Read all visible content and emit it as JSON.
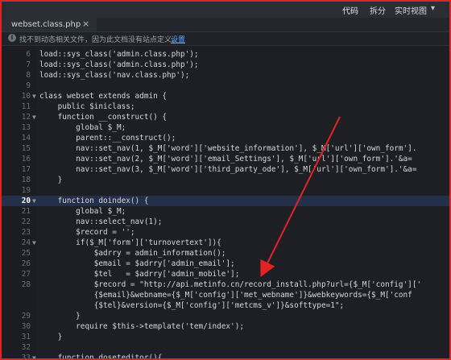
{
  "topbar": {
    "menu": [
      "代码",
      "拆分",
      "实时视图"
    ],
    "dropdown": "▾"
  },
  "tab": {
    "title": "webset.class.php",
    "close": "×"
  },
  "infobar": {
    "message": "找不到动态相关文件，因为此文档没有站点定义。",
    "link": "设置"
  },
  "editor": {
    "lines": [
      {
        "num": "6",
        "code": "load::sys_class('admin.class.php');"
      },
      {
        "num": "7",
        "code": "load::sys_class('admin.class.php');"
      },
      {
        "num": "8",
        "code": "load::sys_class('nav.class.php');"
      },
      {
        "num": "9",
        "code": ""
      },
      {
        "num": "10",
        "code": "class webset extends admin {"
      },
      {
        "num": "11",
        "code": "    public $iniclass;"
      },
      {
        "num": "12",
        "code": "    function __construct() {"
      },
      {
        "num": "13",
        "code": "        global $_M;"
      },
      {
        "num": "14",
        "code": "        parent::__construct();"
      },
      {
        "num": "15",
        "code": "        nav::set_nav(1, $_M['word']['website_information'], $_M['url']['own_form']."
      },
      {
        "num": "16",
        "code": "        nav::set_nav(2, $_M['word']['email_Settings'], $_M['url']['own_form'].'&a="
      },
      {
        "num": "17",
        "code": "        nav::set_nav(3, $_M['word']['third_party_ode'], $_M['url']['own_form'].'&a="
      },
      {
        "num": "18",
        "code": "    }"
      },
      {
        "num": "19",
        "code": ""
      },
      {
        "num": "20",
        "code": "    function doindex() {"
      },
      {
        "num": "21",
        "code": "        global $_M;"
      },
      {
        "num": "22",
        "code": "        nav::select_nav(1);"
      },
      {
        "num": "23",
        "code": "        $record = '';"
      },
      {
        "num": "24",
        "code": "        if($_M['form']['turnovertext']){"
      },
      {
        "num": "25",
        "code": "            $adrry = admin_information();"
      },
      {
        "num": "26",
        "code": "            $email = $adrry['admin_email'];"
      },
      {
        "num": "27",
        "code": "            $tel   = $adrry['admin_mobile'];"
      },
      {
        "num": "28",
        "code": "            $record = \"http://api.metinfo.cn/record_install.php?url={$_M['config']['"
      },
      {
        "num": "",
        "code": "            {$email}&webname={$_M['config']['met_webname']}&webkeywords={$_M['conf"
      },
      {
        "num": "",
        "code": "            {$tel}&version={$_M['config']['metcms_v']}&softtype=1\";"
      },
      {
        "num": "29",
        "code": "        }"
      },
      {
        "num": "30",
        "code": "        require $this->template('tem/index');"
      },
      {
        "num": "31",
        "code": "    }"
      },
      {
        "num": "32",
        "code": ""
      },
      {
        "num": "33",
        "code": "    function doseteditor(){"
      }
    ]
  }
}
